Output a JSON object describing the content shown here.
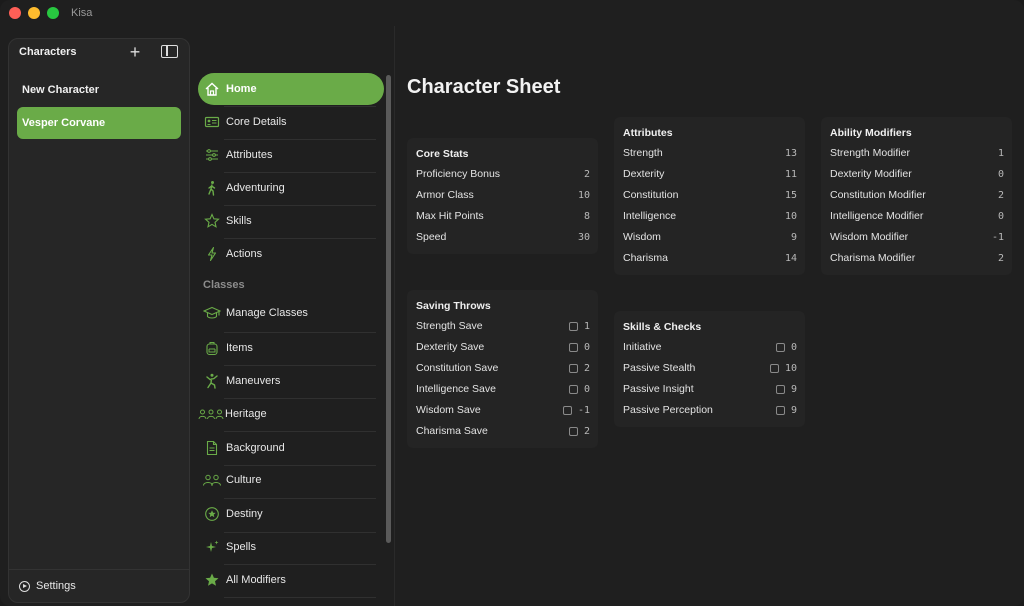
{
  "app": {
    "title": "Kisa"
  },
  "characters": {
    "header": "Characters",
    "items": [
      {
        "name": "New Character"
      },
      {
        "name": "Vesper Corvane"
      }
    ],
    "settings_label": "Settings"
  },
  "nav": {
    "items": [
      {
        "label": "Home",
        "icon": "home-icon"
      },
      {
        "label": "Core Details",
        "icon": "id-card-icon"
      },
      {
        "label": "Attributes",
        "icon": "sliders-icon"
      },
      {
        "label": "Adventuring",
        "icon": "walking-figure-icon"
      },
      {
        "label": "Skills",
        "icon": "star-outline-icon"
      },
      {
        "label": "Actions",
        "icon": "bolt-icon"
      }
    ],
    "section_classes": "Classes",
    "class_items": [
      {
        "label": "Manage Classes",
        "icon": "graduation-cap-icon"
      },
      {
        "label": "Items",
        "icon": "backpack-icon"
      },
      {
        "label": "Maneuvers",
        "icon": "figure-running-icon"
      },
      {
        "label": "Heritage",
        "icon": "people-group-icon"
      },
      {
        "label": "Background",
        "icon": "document-icon"
      },
      {
        "label": "Culture",
        "icon": "people-pair-icon"
      },
      {
        "label": "Destiny",
        "icon": "star-circle-icon"
      },
      {
        "label": "Spells",
        "icon": "sparkles-icon"
      },
      {
        "label": "All Modifiers",
        "icon": "star-filled-icon"
      }
    ]
  },
  "main": {
    "title": "Character Sheet",
    "core_stats": {
      "title": "Core Stats",
      "rows": [
        {
          "k": "Proficiency Bonus",
          "v": "2"
        },
        {
          "k": "Armor Class",
          "v": "10"
        },
        {
          "k": "Max Hit Points",
          "v": "8"
        },
        {
          "k": "Speed",
          "v": "30"
        }
      ]
    },
    "attributes": {
      "title": "Attributes",
      "rows": [
        {
          "k": "Strength",
          "v": "13"
        },
        {
          "k": "Dexterity",
          "v": "11"
        },
        {
          "k": "Constitution",
          "v": "15"
        },
        {
          "k": "Intelligence",
          "v": "10"
        },
        {
          "k": "Wisdom",
          "v": "9"
        },
        {
          "k": "Charisma",
          "v": "14"
        }
      ]
    },
    "ability_modifiers": {
      "title": "Ability Modifiers",
      "rows": [
        {
          "k": "Strength Modifier",
          "v": "1"
        },
        {
          "k": "Dexterity Modifier",
          "v": "0"
        },
        {
          "k": "Constitution Modifier",
          "v": "2"
        },
        {
          "k": "Intelligence Modifier",
          "v": "0"
        },
        {
          "k": "Wisdom Modifier",
          "v": "-1"
        },
        {
          "k": "Charisma Modifier",
          "v": "2"
        }
      ]
    },
    "saving_throws": {
      "title": "Saving Throws",
      "rows": [
        {
          "k": "Strength Save",
          "v": "1"
        },
        {
          "k": "Dexterity Save",
          "v": "0"
        },
        {
          "k": "Constitution Save",
          "v": "2"
        },
        {
          "k": "Intelligence Save",
          "v": "0"
        },
        {
          "k": "Wisdom Save",
          "v": "-1"
        },
        {
          "k": "Charisma Save",
          "v": "2"
        }
      ]
    },
    "skills_checks": {
      "title": "Skills & Checks",
      "rows": [
        {
          "k": "Initiative",
          "v": "0"
        },
        {
          "k": "Passive Stealth",
          "v": "10"
        },
        {
          "k": "Passive Insight",
          "v": "9"
        },
        {
          "k": "Passive Perception",
          "v": "9"
        }
      ]
    }
  },
  "colors": {
    "accent": "#6aab48",
    "background": "#1f1f1f",
    "card": "#242424"
  }
}
